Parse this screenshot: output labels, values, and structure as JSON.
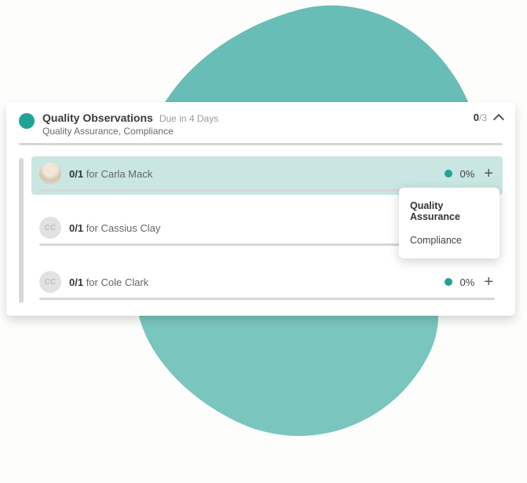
{
  "header": {
    "title": "Quality Observations",
    "due": "Due in 4 Days",
    "subtitle": "Quality Assurance, Compliance",
    "count_done": "0",
    "count_total": "/3"
  },
  "rows": [
    {
      "initials": "",
      "photo": true,
      "count": "0/1",
      "for": " for ",
      "name": "Carla Mack",
      "percent": "0%",
      "highlight": true,
      "show_status": true
    },
    {
      "initials": "CC",
      "photo": false,
      "count": "0/1",
      "for": " for ",
      "name": "Cassius Clay",
      "percent": "",
      "highlight": false,
      "show_status": false
    },
    {
      "initials": "CC",
      "photo": false,
      "count": "0/1",
      "for": " for ",
      "name": "Cole Clark",
      "percent": "0%",
      "highlight": false,
      "show_status": true
    }
  ],
  "popover": {
    "items": [
      "Quality Assurance",
      "Compliance"
    ]
  }
}
